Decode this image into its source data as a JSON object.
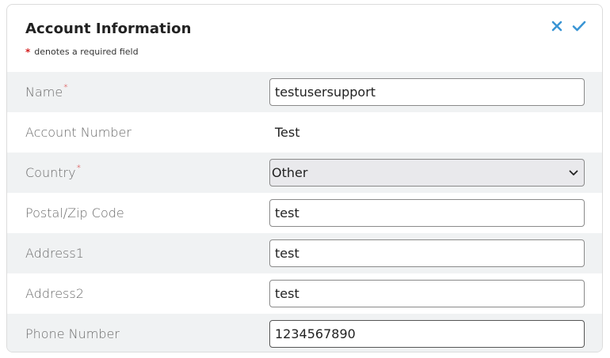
{
  "form": {
    "title": "Account Information",
    "required_note": "denotes a required field",
    "required_marker": "*",
    "colors": {
      "required": "#d42020",
      "accent": "#3a95d4",
      "shaded_row": "#f0f2f3"
    },
    "actions": {
      "cancel_icon": "close-icon",
      "save_icon": "check-icon"
    }
  },
  "fields": {
    "name": {
      "label": "Name",
      "required": true,
      "value": "testusersupport"
    },
    "account_number": {
      "label": "Account Number",
      "value": "Test"
    },
    "country": {
      "label": "Country",
      "required": true,
      "selected": "Other"
    },
    "postal": {
      "label": "Postal/Zip Code",
      "value": "test"
    },
    "address1": {
      "label": "Address1",
      "value": "test"
    },
    "address2": {
      "label": "Address2",
      "value": "test"
    },
    "phone": {
      "label": "Phone Number",
      "value": "1234567890"
    }
  }
}
